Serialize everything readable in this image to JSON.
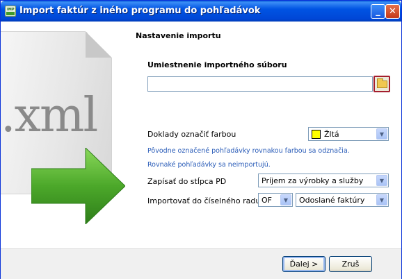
{
  "window": {
    "title": "Import faktúr z iného programu do pohľadávok"
  },
  "titlebar": {
    "minimize_symbol": "_",
    "close_symbol": "✕"
  },
  "illustration": {
    "file_ext": ".xml"
  },
  "settings": {
    "section_title": "Nastavenie importu",
    "location_label": "Umiestnenie importného súboru",
    "location_value": "",
    "color_label": "Doklady označiť farbou",
    "color_value": "Žltá",
    "color_hex": "#ffff00",
    "note1": "Pôvodne označené pohľadávky rovnakou farbou sa odznačia.",
    "note2": "Rovnaké pohľadávky sa neimportujú.",
    "column_label": "Zapísať do stĺpca PD",
    "column_value": "Príjem za výrobky a služby",
    "series_label": "Importovať do číselného radu",
    "series_code": "OF",
    "series_name": "Odoslané faktúry"
  },
  "footer": {
    "next_label": "Ďalej >",
    "cancel_label": "Zruš"
  },
  "colors": {
    "title_blue": "#0054e3",
    "accent_red": "#a31e2e",
    "arrow_green": "#4ca82a"
  }
}
